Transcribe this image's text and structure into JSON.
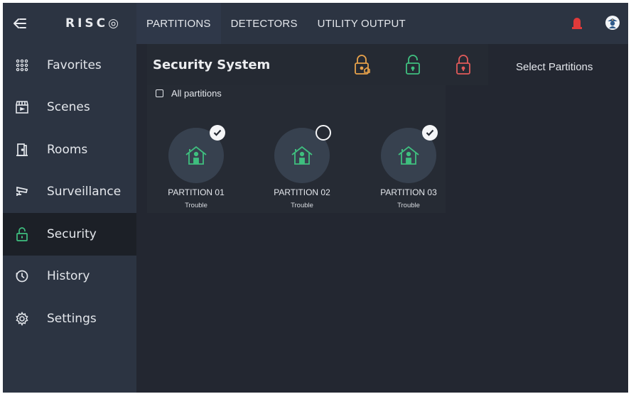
{
  "app": {
    "logo": "RISC◎"
  },
  "sidebar": {
    "items": [
      {
        "label": "Favorites",
        "icon": "grid-dots-icon"
      },
      {
        "label": "Scenes",
        "icon": "clapperboard-icon"
      },
      {
        "label": "Rooms",
        "icon": "door-icon"
      },
      {
        "label": "Surveillance",
        "icon": "camera-icon"
      },
      {
        "label": "Security",
        "icon": "lock-icon",
        "active": true
      },
      {
        "label": "History",
        "icon": "clock-icon"
      },
      {
        "label": "Settings",
        "icon": "gear-icon"
      }
    ]
  },
  "topbar": {
    "tabs": [
      {
        "label": "PARTITIONS",
        "active": true
      },
      {
        "label": "DETECTORS"
      },
      {
        "label": "UTILITY OUTPUT"
      }
    ]
  },
  "header": {
    "title": "Security System",
    "select_partitions": "Select Partitions"
  },
  "panel": {
    "all_partitions": "All partitions",
    "partitions": [
      {
        "name": "PARTITION 01",
        "status": "Trouble",
        "selected": true
      },
      {
        "name": "PARTITION 02",
        "status": "Trouble",
        "selected": false
      },
      {
        "name": "PARTITION 03",
        "status": "Trouble",
        "selected": true
      }
    ]
  },
  "colors": {
    "background": "#232731",
    "sidebar": "#2c3442",
    "accent_green": "#3fbf7f",
    "lock_orange": "#e8a24a",
    "lock_red": "#e15a5a",
    "alarm_red": "#e03a3a"
  }
}
